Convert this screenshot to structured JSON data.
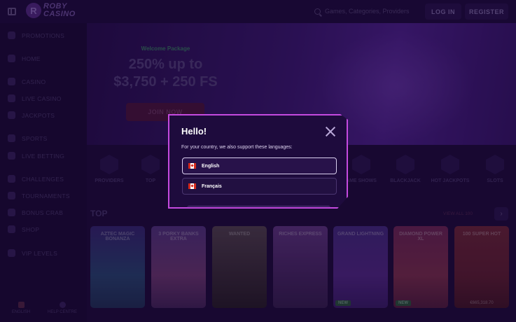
{
  "header": {
    "logo_line1": "ROBY",
    "logo_line2": "CASINO",
    "logo_mark": "R",
    "search_placeholder": "Games, Categories, Providers",
    "login_label": "LOG IN",
    "register_label": "REGISTER"
  },
  "sidebar": {
    "items": [
      {
        "label": "PROMOTIONS",
        "icon": "gift-icon"
      },
      {
        "label": "HOME",
        "icon": "home-icon"
      },
      {
        "label": "CASINO",
        "icon": "casino-chip-icon"
      },
      {
        "label": "LIVE CASINO",
        "icon": "live-icon"
      },
      {
        "label": "JACKPOTS",
        "icon": "diamond-icon"
      },
      {
        "label": "SPORTS",
        "icon": "ball-icon"
      },
      {
        "label": "LIVE BETTING",
        "icon": "ticket-icon"
      },
      {
        "label": "CHALLENGES",
        "icon": "trophy-icon"
      },
      {
        "label": "TOURNAMENTS",
        "icon": "cup-icon"
      },
      {
        "label": "BONUS CRAB",
        "icon": "crab-icon"
      },
      {
        "label": "SHOP",
        "icon": "cart-icon"
      },
      {
        "label": "VIP LEVELS",
        "icon": "crown-icon"
      }
    ],
    "footer_language": "ENGLISH",
    "footer_help": "HELP CENTRE"
  },
  "banner": {
    "welcome": "Welcome Package",
    "headline_line1": "250% up to",
    "headline_line2": "$3,750 + 250 FS",
    "cta": "JOIN NOW"
  },
  "categories": [
    {
      "label": "PROVIDERS",
      "icon": "providers-icon"
    },
    {
      "label": "TOP",
      "icon": "top-icon"
    },
    {
      "label": "AME SHOWS",
      "icon": "game-shows-icon"
    },
    {
      "label": "BLACKJACK",
      "icon": "spade-icon"
    },
    {
      "label": "HOT JACKPOTS",
      "icon": "flame-icon"
    },
    {
      "label": "SLOTS",
      "icon": "slot-icon"
    }
  ],
  "top_section": {
    "title": "TOP",
    "view_all": "VIEW ALL 100",
    "games": [
      {
        "name": "AZTEC MAGIC BONANZA",
        "badge": "",
        "jackpot": ""
      },
      {
        "name": "3 PORKY BANKS EXTRA",
        "badge": "",
        "jackpot": ""
      },
      {
        "name": "WANTED",
        "badge": "",
        "jackpot": ""
      },
      {
        "name": "RICHES EXPRESS",
        "badge": "",
        "jackpot": ""
      },
      {
        "name": "GRAND LIGHTNING",
        "badge": "NEW",
        "jackpot": ""
      },
      {
        "name": "DIAMOND POWER XL",
        "badge": "NEW",
        "jackpot": ""
      },
      {
        "name": "100 SUPER HOT",
        "badge": "",
        "jackpot": "€665,318.70"
      }
    ]
  },
  "modal": {
    "title": "Hello!",
    "subtitle": "For your country, we also support these languages:",
    "languages": [
      {
        "label": "English",
        "selected": true
      },
      {
        "label": "Français",
        "selected": false
      }
    ]
  },
  "colors": {
    "accent": "#c54ae0",
    "background": "#1f0b3d",
    "flag_red": "#d52b1e"
  }
}
